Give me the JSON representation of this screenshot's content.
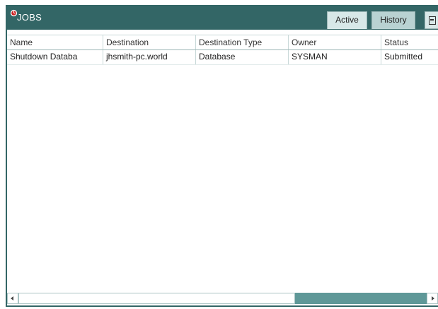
{
  "panel": {
    "title": "JOBS",
    "title_icon": "clock-icon",
    "accent_color": "#336666"
  },
  "tabs": {
    "active_label": "Active",
    "history_label": "History",
    "extra_icon": "export-icon"
  },
  "table": {
    "columns": [
      "Name",
      "Destination",
      "Destination Type",
      "Owner",
      "Status"
    ],
    "rows": [
      [
        "Shutdown Databa",
        "jhsmith-pc.world",
        "Database",
        "SYSMAN",
        "Submitted"
      ]
    ]
  },
  "scrollbar": {
    "left_icon": "arrow-left-icon",
    "right_icon": "arrow-right-icon"
  }
}
